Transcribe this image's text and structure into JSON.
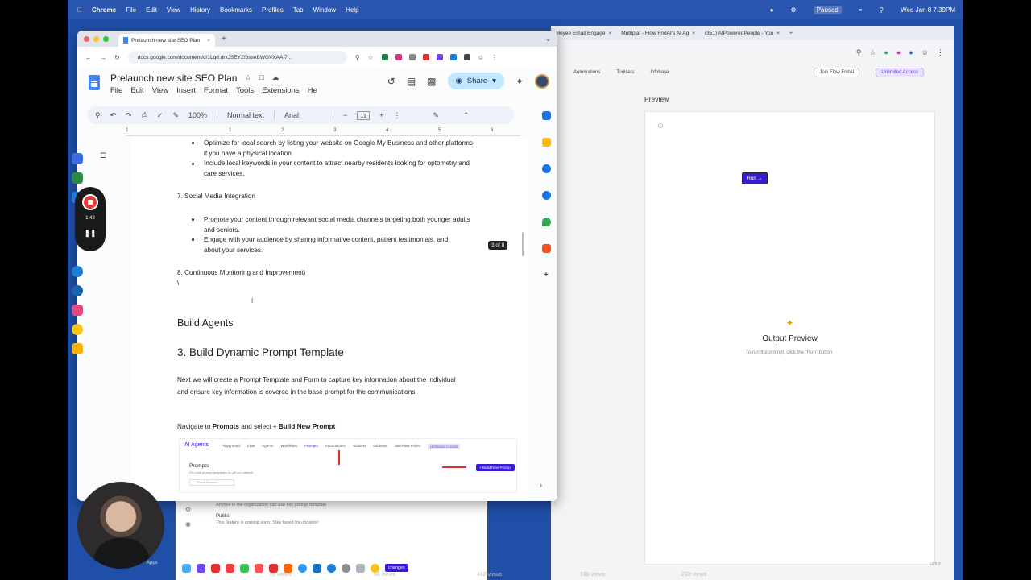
{
  "menubar": {
    "app": "Chrome",
    "items": [
      "File",
      "Edit",
      "View",
      "History",
      "Bookmarks",
      "Profiles",
      "Tab",
      "Window",
      "Help"
    ],
    "paused": "Paused",
    "clock": "Wed Jan 8  7:39PM"
  },
  "back_window": {
    "tabs": [
      "ployee Email Engage",
      "Multiplai - Flow FridAI's AI Ag",
      "(351) AIPoweredPeople - You"
    ],
    "nav": [
      "Automations",
      "Toolsets",
      "Infobase"
    ],
    "join_flow": "Join Flow FridAI",
    "unlimited": "Unlimited Access",
    "preview_label": "Preview",
    "run_label": "Run →",
    "output_title": "Output Preview",
    "output_sub": "To run the prompt, click the \"Run\" button.",
    "version": "v2.5.0"
  },
  "lower_window": {
    "line1": "Anyone in the organization can use this prompt template",
    "public_label": "Public",
    "public_sub": "This feature is coming soon. Stay tuned for updates!"
  },
  "views": [
    "76 views",
    "56 views",
    "412 views",
    "139 views",
    "232 views"
  ],
  "docs": {
    "tab_title": "Prelaunch new site SEO Plan",
    "url": "docs.google.com/document/d/1Lqd.drxJSEYZf6sseBWGVXAAI7...",
    "title": "Prelaunch new site SEO Plan",
    "menu": [
      "File",
      "Edit",
      "View",
      "Insert",
      "Format",
      "Tools",
      "Extensions",
      "He"
    ],
    "share": "Share",
    "zoom": "100%",
    "style": "Normal text",
    "font": "Arial",
    "font_size": "11",
    "ruler": [
      "1",
      "1",
      "2",
      "3",
      "4",
      "5",
      "6"
    ],
    "bullets_local": [
      "Optimize for local search by listing your website on Google My Business and other platforms",
      "if you have a physical location.",
      "Include local keywords in your content to attract nearby residents looking for optometry and",
      "care services."
    ],
    "section7": "7. Social Media Integration",
    "bullets_social": [
      "Promote your content through relevant social media channels targeting both younger adults",
      "and seniors.",
      "Engage with your audience by sharing informative content, patient testimonials, and",
      "about your services."
    ],
    "page_badge": "3 of 8",
    "section8": "8. Continuous Monitoring and Improvement\\",
    "backslash": "\\",
    "h_build_agents": "Build Agents",
    "h_dynamic": "3. Build Dynamic Prompt Template",
    "para1": "Next we will create a Prompt Template and Form to capture key information about the individual",
    "para2": "and ensure key information is covered in the base prompt for the communications.",
    "navigate_prefix": "Navigate to ",
    "navigate_prompts": "Prompts",
    "navigate_mid": " and select + ",
    "navigate_build": "Build New Prompt"
  },
  "embedded": {
    "logo": "AI Agents",
    "nav": [
      "Playground",
      "Chat",
      "Agents",
      "Workflows",
      "Prompts",
      "Automations",
      "Toolsets",
      "Infobase",
      "Join Flow FridAI"
    ],
    "unlimited": "Unlimited Access",
    "prompts_title": "Prompts",
    "prompts_sub": "Pre-built prompt templates to get you started",
    "build_btn": "+ Build New Prompt",
    "search": "Search Prompts"
  },
  "recorder": {
    "time": "1:43"
  },
  "dock": {
    "changes": "changes",
    "apps": "Apps"
  }
}
